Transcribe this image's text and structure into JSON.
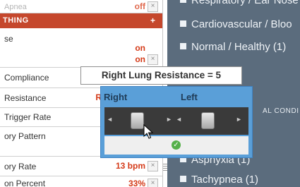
{
  "settings_panel": {
    "rows": [
      {
        "label": "Apnea",
        "value": "off"
      },
      {
        "label": "se"
      },
      {
        "label": "",
        "value": "on"
      },
      {
        "label": "",
        "value": "on"
      },
      {
        "label": "Compliance"
      },
      {
        "label": "Resistance",
        "value": "R"
      },
      {
        "label": "Trigger Rate"
      },
      {
        "label": "ory Pattern"
      },
      {
        "label": "ory Rate",
        "value": "13 bpm"
      },
      {
        "label": "on Percent",
        "value": "33%"
      }
    ],
    "section_header": {
      "title": "THING",
      "add_symbol": "+"
    },
    "clear_symbol": "×"
  },
  "categories": {
    "items": [
      "Respiratory / Ear Nose",
      "Cardiovascular / Bloo",
      "Normal / Healthy (1)",
      "Asphyxia (1)",
      "Tachypnea (1)"
    ],
    "heading": "AL CONDI"
  },
  "tooltip": {
    "text": "Right Lung Resistance = 5"
  },
  "slider_popup": {
    "right_label": "Right",
    "left_label": "Left",
    "arrow_left": "◄",
    "arrow_right": "►",
    "right_value_fraction": 0.45,
    "left_value_fraction": 0.45,
    "confirm_symbol": "✓"
  },
  "colors": {
    "section_header": "#c5472c",
    "value_red": "#d43a18",
    "popup_blue": "#5a9fd8",
    "background": "#5b6c7d",
    "confirm_green": "#55b04a"
  }
}
